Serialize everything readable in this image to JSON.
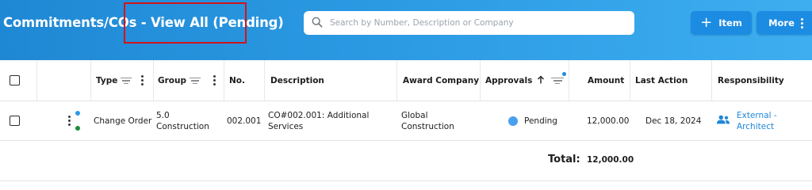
{
  "header": {
    "title_main": "Commitments/COs",
    "title_sep": " - ",
    "title_view": "View All (Pending)",
    "search_placeholder": "Search by Number, Description or Company",
    "item_button": "Item",
    "more_button": "More"
  },
  "table": {
    "columns": {
      "type": "Type",
      "group": "Group",
      "number": "No.",
      "description": "Description",
      "award_company": "Award Company",
      "approvals": "Approvals",
      "amount": "Amount",
      "last_action": "Last Action",
      "responsibility": "Responsibility"
    },
    "rows": [
      {
        "type": "Change Order",
        "group_line1": "5.0",
        "group_line2": "Construction",
        "number": "002.001",
        "description_line1": "CO#002.001: Additional",
        "description_line2": "Services",
        "award_company_line1": "Global",
        "award_company_line2": "Construction",
        "approval_status": "Pending",
        "amount": "12,000.00",
        "last_action": "Dec 18, 2024",
        "responsibility_line1": "External -",
        "responsibility_line2": "Architect"
      }
    ],
    "total_label": "Total:",
    "total_value": "12,000.00"
  },
  "colors": {
    "header_gradient_start": "#1f88d4",
    "header_gradient_end": "#3eaef0",
    "button": "#1c8ce3",
    "highlight_box": "#d3131d",
    "pending_dot": "#4a9fef",
    "link": "#1f87d9",
    "row_indicator_blue": "#2f9ae8",
    "row_indicator_green": "#1e8a3a"
  }
}
